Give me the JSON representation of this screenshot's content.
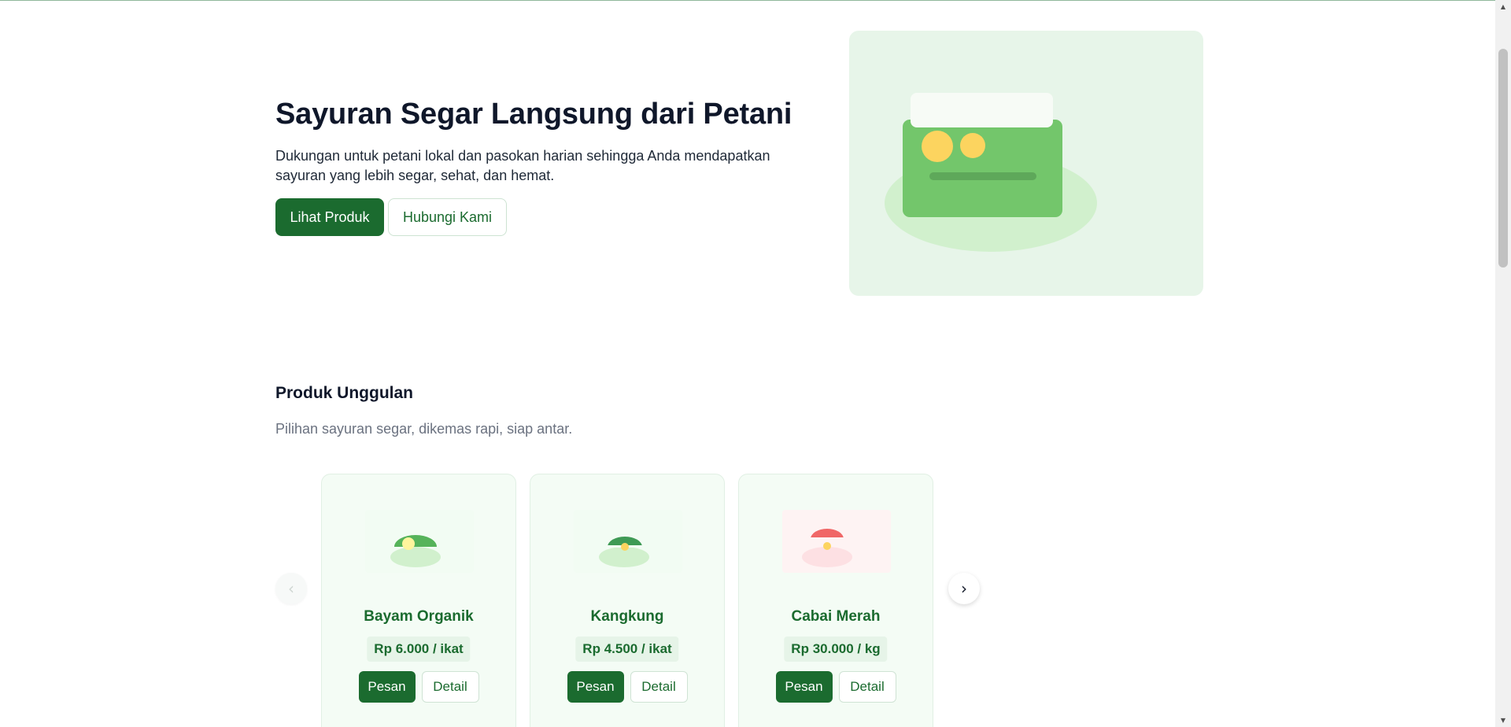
{
  "hero": {
    "title": "Sayuran Segar Langsung dari Petani",
    "description": "Dukungan untuk petani lokal dan pasokan harian sehingga Anda mendapatkan sayuran yang lebih segar, sehat, dan hemat.",
    "primary_button": "Lihat Produk",
    "secondary_button": "Hubungi Kami"
  },
  "section": {
    "title": "Produk Unggulan",
    "subtitle": "Pilihan sayuran segar, dikemas rapi, siap antar."
  },
  "carousel": {
    "prev_icon": "‹",
    "next_icon": "›",
    "products": [
      {
        "name": "Bayam Organik",
        "price": "Rp 6.000 / ikat",
        "order_label": "Pesan",
        "detail_label": "Detail"
      },
      {
        "name": "Kangkung",
        "price": "Rp 4.500 / ikat",
        "order_label": "Pesan",
        "detail_label": "Detail"
      },
      {
        "name": "Cabai Merah",
        "price": "Rp 30.000 / kg",
        "order_label": "Pesan",
        "detail_label": "Detail"
      }
    ]
  },
  "colors": {
    "brand_green": "#1b6b2f",
    "hero_bg": "#e7f5e9",
    "card_bg": "#f4fcf5"
  }
}
